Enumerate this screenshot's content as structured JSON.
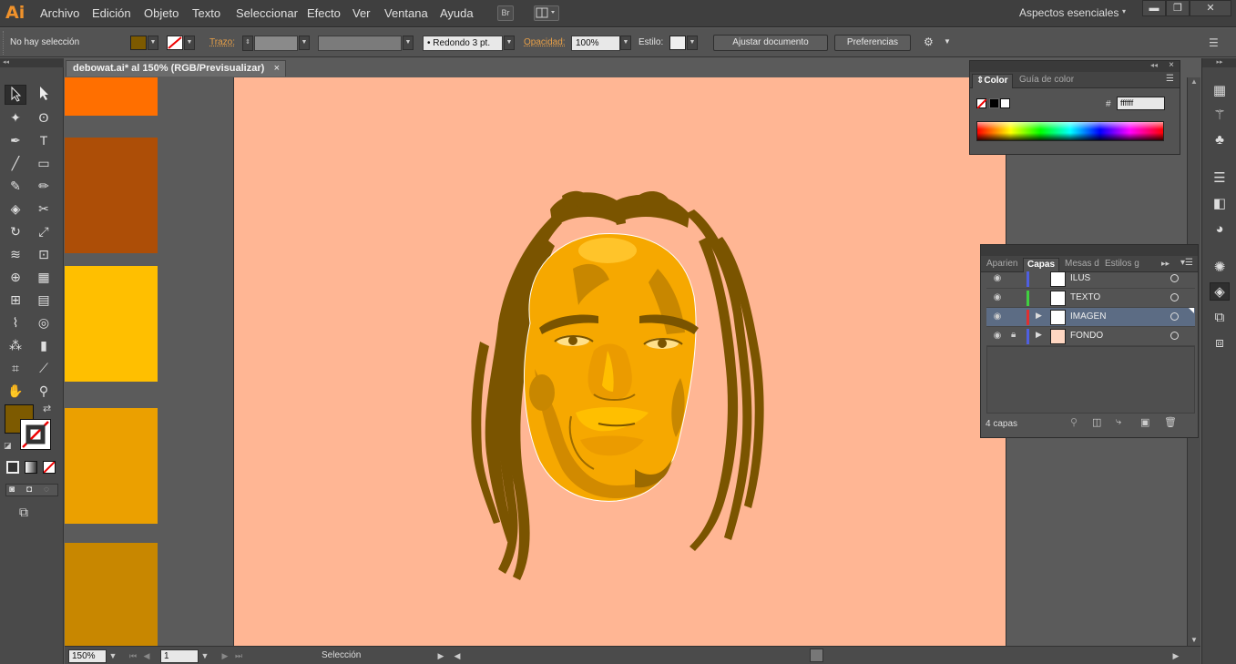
{
  "menu": {
    "logo": "Ai",
    "items": [
      "Archivo",
      "Edición",
      "Objeto",
      "Texto",
      "Seleccionar",
      "Efecto",
      "Ver",
      "Ventana",
      "Ayuda"
    ],
    "bridge_label": "Br",
    "workspace": "Aspectos esenciales",
    "window_controls": [
      "▬",
      "❐",
      "✕"
    ]
  },
  "control": {
    "selection_status": "No hay selección",
    "fill_color": "#7d5a00",
    "stroke_label": "Trazo:",
    "brush_label": "Redondo 3 pt.",
    "opacity_label": "Opacidad:",
    "opacity_value": "100%",
    "style_label": "Estilo:",
    "adjust_doc_btn": "Ajustar documento",
    "prefs_btn": "Preferencias"
  },
  "document": {
    "tab_title": "debowat.ai* al 150% (RGB/Previsualizar)",
    "tab_close": "×",
    "artboard_color": "#ffb694",
    "swatches": [
      "#ff6f00",
      "#ad4e07",
      "#ffbf00",
      "#eba000",
      "#c88700"
    ]
  },
  "status": {
    "zoom": "150%",
    "artboard_number": "1",
    "tool_name": "Selección"
  },
  "color_panel": {
    "tabs": [
      "Color",
      "Guía de color"
    ],
    "hash": "#",
    "hex_value": "ffffff"
  },
  "layers_panel": {
    "tabs": [
      "Aparien",
      "Capas",
      "Mesas d",
      "Estilos g"
    ],
    "active_tab": "Capas",
    "layers": [
      {
        "name": "ILUS",
        "color": "#4f5fe0",
        "locked": false,
        "expandable": false,
        "selected": false
      },
      {
        "name": "TEXTO",
        "color": "#40d040",
        "locked": false,
        "expandable": false,
        "selected": false
      },
      {
        "name": "IMAGEN",
        "color": "#e03030",
        "locked": false,
        "expandable": true,
        "selected": true
      },
      {
        "name": "FONDO",
        "color": "#4f5fe0",
        "locked": true,
        "expandable": true,
        "selected": false
      }
    ],
    "count_label": "4 capas"
  }
}
